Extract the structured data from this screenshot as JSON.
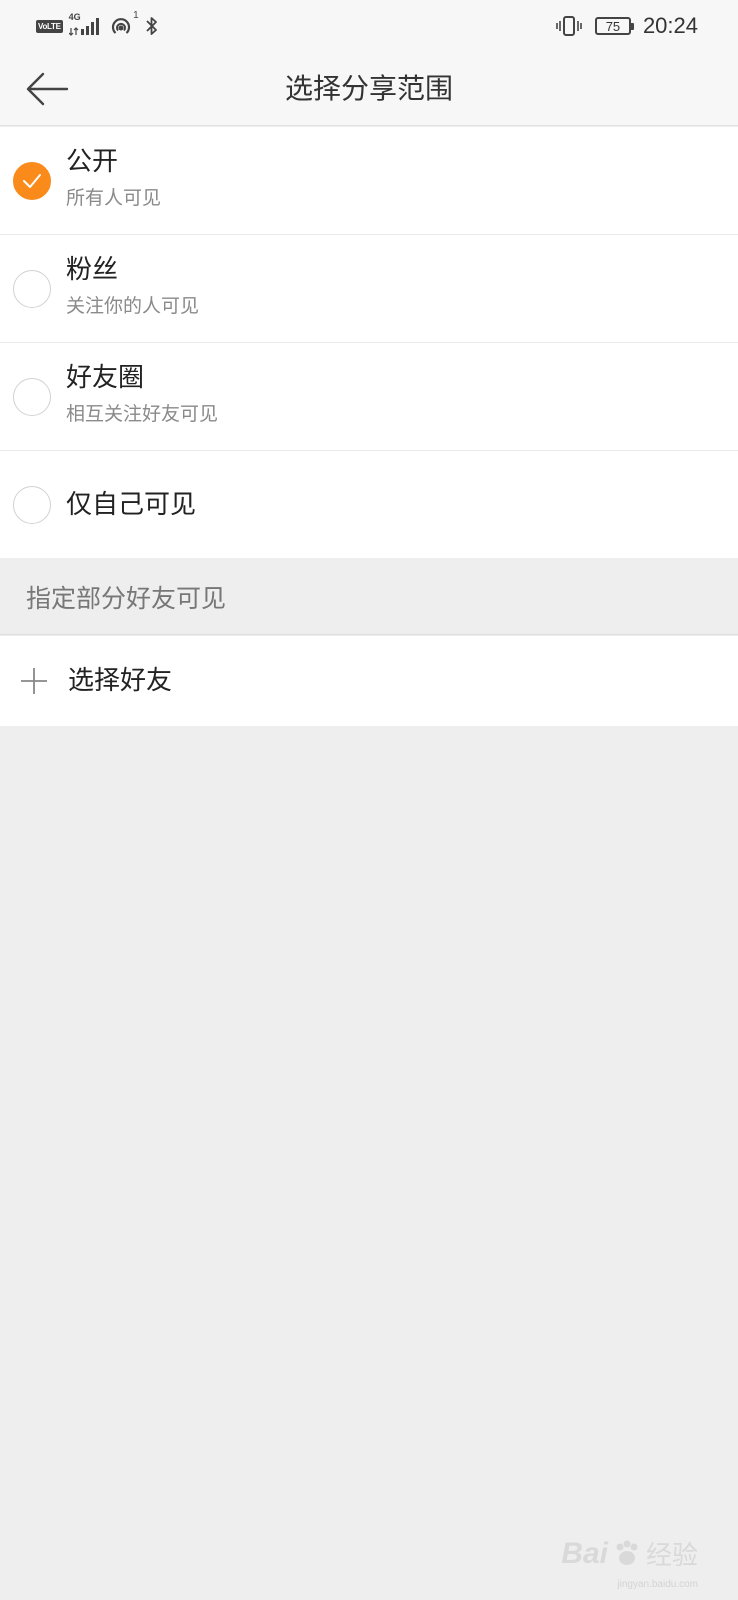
{
  "status_bar": {
    "volte_label": "VoLTE",
    "network_label": "4G",
    "hotspot_count": "1",
    "battery_level": "75",
    "time": "20:24"
  },
  "nav": {
    "title": "选择分享范围"
  },
  "options": [
    {
      "title": "公开",
      "subtitle": "所有人可见",
      "checked": true
    },
    {
      "title": "粉丝",
      "subtitle": "关注你的人可见",
      "checked": false
    },
    {
      "title": "好友圈",
      "subtitle": "相互关注好友可见",
      "checked": false
    },
    {
      "title": "仅自己可见",
      "checked": false
    }
  ],
  "section": {
    "label": "指定部分好友可见"
  },
  "select_friends": {
    "label": "选择好友"
  },
  "watermark": {
    "brand": "Bai",
    "brand_suffix": "经验",
    "url": "jingyan.baidu.com"
  },
  "colors": {
    "accent": "#fa8a1a",
    "page_background": "#eeeeee"
  }
}
